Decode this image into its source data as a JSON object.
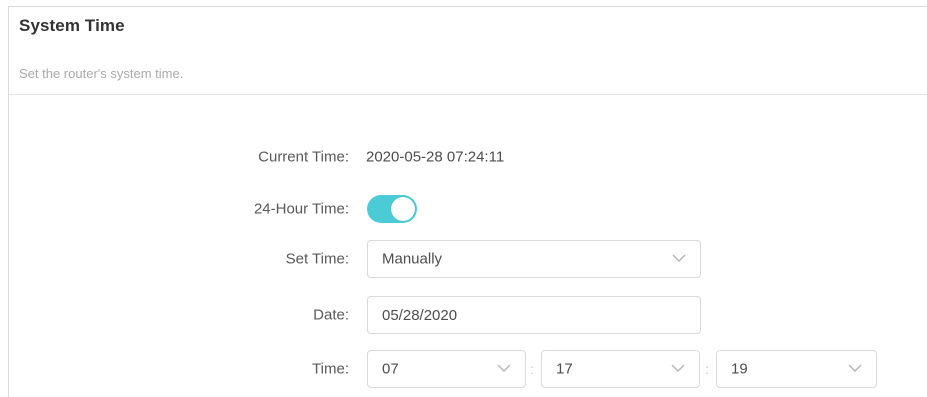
{
  "header": {
    "title": "System Time",
    "subtitle": "Set the router's system time."
  },
  "form": {
    "current_time": {
      "label": "Current Time:",
      "value": "2020-05-28 07:24:11"
    },
    "hour24": {
      "label": "24-Hour Time:",
      "enabled": true,
      "accent_color": "#4acbd6"
    },
    "set_time": {
      "label": "Set Time:",
      "selected": "Manually"
    },
    "date": {
      "label": "Date:",
      "value": "05/28/2020"
    },
    "time": {
      "label": "Time:",
      "hour": "07",
      "minute": "17",
      "second": "19",
      "separator": ":"
    }
  },
  "icons": {
    "dropdown": "chevron-down-icon"
  }
}
